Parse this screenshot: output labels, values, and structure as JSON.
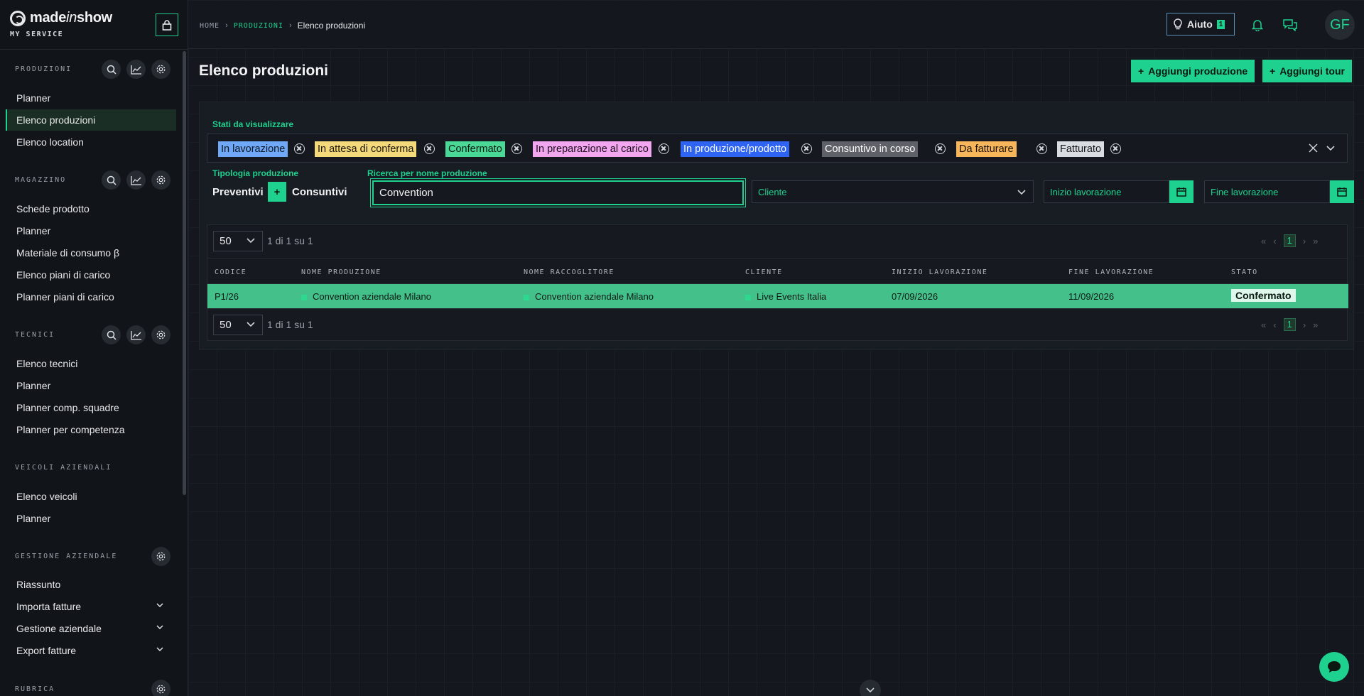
{
  "brand": {
    "name_bold": "made",
    "name_italic": "in",
    "name_rest": "show",
    "service": "MY SERVICE"
  },
  "sidebar": {
    "sections": [
      {
        "title": "PRODUZIONI",
        "items": [
          "Planner",
          "Elenco produzioni",
          "Elenco location"
        ]
      },
      {
        "title": "MAGAZZINO",
        "items": [
          "Schede prodotto",
          "Planner",
          "Materiale di consumo β",
          "Elenco piani di carico",
          "Planner piani di carico"
        ]
      },
      {
        "title": "TECNICI",
        "items": [
          "Elenco tecnici",
          "Planner",
          "Planner comp. squadre",
          "Planner per competenza"
        ]
      },
      {
        "title": "VEICOLI AZIENDALI",
        "items": [
          "Elenco veicoli",
          "Planner"
        ]
      },
      {
        "title": "GESTIONE AZIENDALE",
        "items": [
          "Riassunto",
          "Importa fatture",
          "Gestione aziendale",
          "Export fatture"
        ]
      },
      {
        "title": "RUBRICA",
        "items": []
      }
    ],
    "active_item": "Elenco produzioni"
  },
  "header": {
    "breadcrumb": {
      "home": "HOME",
      "section": "PRODUZIONI",
      "current": "Elenco produzioni"
    },
    "help_label": "Aiuto",
    "help_count": "1",
    "avatar_initials": "GF"
  },
  "page": {
    "title": "Elenco produzioni",
    "add_production": "Aggiungi produzione",
    "add_tour": "Aggiungi tour"
  },
  "filters": {
    "states_label": "Stati da visualizzare",
    "states": [
      {
        "label": "In lavorazione",
        "bg": "#6ea8f7",
        "fg": "#0d1620"
      },
      {
        "label": "In attesa di conferma",
        "bg": "#f3d97a",
        "fg": "#1a1508"
      },
      {
        "label": "Confermato",
        "bg": "#4ad896",
        "fg": "#0b1912"
      },
      {
        "label": "In preparazione al carico",
        "bg": "#f2a6ef",
        "fg": "#1a0d1a"
      },
      {
        "label": "In produzione/prodotto",
        "bg": "#2f64f2",
        "fg": "#ffffff"
      },
      {
        "label": "Consuntivo in corso",
        "bg": "#5e6268",
        "fg": "#ffffff"
      },
      {
        "label": "Da fatturare",
        "bg": "#f6b659",
        "fg": "#1a1205"
      },
      {
        "label": "Fatturato",
        "bg": "#d9dce0",
        "fg": "#14171c"
      }
    ],
    "type_label": "Tipologia produzione",
    "type_left": "Preventivi",
    "type_plus": "+",
    "type_right": "Consuntivi",
    "search_label": "Ricerca per nome produzione",
    "search_value": "Convention",
    "client_placeholder": "Cliente",
    "start_placeholder": "Inizio lavorazione",
    "end_placeholder": "Fine lavorazione"
  },
  "table": {
    "page_size": "50",
    "page_info": "1 di 1 su 1",
    "current_page": "1",
    "columns": [
      "CODICE",
      "NOME PRODUZIONE",
      "NOME RACCOGLITORE",
      "CLIENTE",
      "INIZIO LAVORAZIONE",
      "FINE LAVORAZIONE",
      "STATO"
    ],
    "rows": [
      {
        "code": "P1/26",
        "name": "Convention aziendale Milano",
        "collector": "Convention aziendale Milano",
        "client": "Live Events Italia",
        "start": "07/09/2026",
        "end": "11/09/2026",
        "status": "Confermato"
      }
    ]
  },
  "colors": {
    "accent": "#1fd18e",
    "row_highlight": "#44c08a"
  }
}
